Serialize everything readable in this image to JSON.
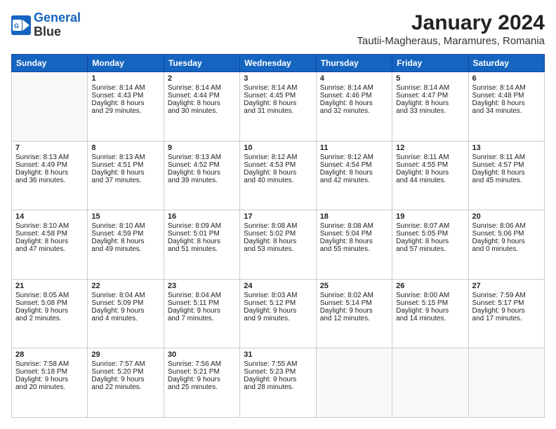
{
  "header": {
    "logo_line1": "General",
    "logo_line2": "Blue",
    "month_year": "January 2024",
    "location": "Tautii-Magheraus, Maramures, Romania"
  },
  "days_of_week": [
    "Sunday",
    "Monday",
    "Tuesday",
    "Wednesday",
    "Thursday",
    "Friday",
    "Saturday"
  ],
  "weeks": [
    [
      {
        "day": "",
        "info": ""
      },
      {
        "day": "1",
        "info": "Sunrise: 8:14 AM\nSunset: 4:43 PM\nDaylight: 8 hours\nand 29 minutes."
      },
      {
        "day": "2",
        "info": "Sunrise: 8:14 AM\nSunset: 4:44 PM\nDaylight: 8 hours\nand 30 minutes."
      },
      {
        "day": "3",
        "info": "Sunrise: 8:14 AM\nSunset: 4:45 PM\nDaylight: 8 hours\nand 31 minutes."
      },
      {
        "day": "4",
        "info": "Sunrise: 8:14 AM\nSunset: 4:46 PM\nDaylight: 8 hours\nand 32 minutes."
      },
      {
        "day": "5",
        "info": "Sunrise: 8:14 AM\nSunset: 4:47 PM\nDaylight: 8 hours\nand 33 minutes."
      },
      {
        "day": "6",
        "info": "Sunrise: 8:14 AM\nSunset: 4:48 PM\nDaylight: 8 hours\nand 34 minutes."
      }
    ],
    [
      {
        "day": "7",
        "info": "Sunrise: 8:13 AM\nSunset: 4:49 PM\nDaylight: 8 hours\nand 36 minutes."
      },
      {
        "day": "8",
        "info": "Sunrise: 8:13 AM\nSunset: 4:51 PM\nDaylight: 8 hours\nand 37 minutes."
      },
      {
        "day": "9",
        "info": "Sunrise: 8:13 AM\nSunset: 4:52 PM\nDaylight: 8 hours\nand 39 minutes."
      },
      {
        "day": "10",
        "info": "Sunrise: 8:12 AM\nSunset: 4:53 PM\nDaylight: 8 hours\nand 40 minutes."
      },
      {
        "day": "11",
        "info": "Sunrise: 8:12 AM\nSunset: 4:54 PM\nDaylight: 8 hours\nand 42 minutes."
      },
      {
        "day": "12",
        "info": "Sunrise: 8:11 AM\nSunset: 4:55 PM\nDaylight: 8 hours\nand 44 minutes."
      },
      {
        "day": "13",
        "info": "Sunrise: 8:11 AM\nSunset: 4:57 PM\nDaylight: 8 hours\nand 45 minutes."
      }
    ],
    [
      {
        "day": "14",
        "info": "Sunrise: 8:10 AM\nSunset: 4:58 PM\nDaylight: 8 hours\nand 47 minutes."
      },
      {
        "day": "15",
        "info": "Sunrise: 8:10 AM\nSunset: 4:59 PM\nDaylight: 8 hours\nand 49 minutes."
      },
      {
        "day": "16",
        "info": "Sunrise: 8:09 AM\nSunset: 5:01 PM\nDaylight: 8 hours\nand 51 minutes."
      },
      {
        "day": "17",
        "info": "Sunrise: 8:08 AM\nSunset: 5:02 PM\nDaylight: 8 hours\nand 53 minutes."
      },
      {
        "day": "18",
        "info": "Sunrise: 8:08 AM\nSunset: 5:04 PM\nDaylight: 8 hours\nand 55 minutes."
      },
      {
        "day": "19",
        "info": "Sunrise: 8:07 AM\nSunset: 5:05 PM\nDaylight: 8 hours\nand 57 minutes."
      },
      {
        "day": "20",
        "info": "Sunrise: 8:06 AM\nSunset: 5:06 PM\nDaylight: 9 hours\nand 0 minutes."
      }
    ],
    [
      {
        "day": "21",
        "info": "Sunrise: 8:05 AM\nSunset: 5:08 PM\nDaylight: 9 hours\nand 2 minutes."
      },
      {
        "day": "22",
        "info": "Sunrise: 8:04 AM\nSunset: 5:09 PM\nDaylight: 9 hours\nand 4 minutes."
      },
      {
        "day": "23",
        "info": "Sunrise: 8:04 AM\nSunset: 5:11 PM\nDaylight: 9 hours\nand 7 minutes."
      },
      {
        "day": "24",
        "info": "Sunrise: 8:03 AM\nSunset: 5:12 PM\nDaylight: 9 hours\nand 9 minutes."
      },
      {
        "day": "25",
        "info": "Sunrise: 8:02 AM\nSunset: 5:14 PM\nDaylight: 9 hours\nand 12 minutes."
      },
      {
        "day": "26",
        "info": "Sunrise: 8:00 AM\nSunset: 5:15 PM\nDaylight: 9 hours\nand 14 minutes."
      },
      {
        "day": "27",
        "info": "Sunrise: 7:59 AM\nSunset: 5:17 PM\nDaylight: 9 hours\nand 17 minutes."
      }
    ],
    [
      {
        "day": "28",
        "info": "Sunrise: 7:58 AM\nSunset: 5:18 PM\nDaylight: 9 hours\nand 20 minutes."
      },
      {
        "day": "29",
        "info": "Sunrise: 7:57 AM\nSunset: 5:20 PM\nDaylight: 9 hours\nand 22 minutes."
      },
      {
        "day": "30",
        "info": "Sunrise: 7:56 AM\nSunset: 5:21 PM\nDaylight: 9 hours\nand 25 minutes."
      },
      {
        "day": "31",
        "info": "Sunrise: 7:55 AM\nSunset: 5:23 PM\nDaylight: 9 hours\nand 28 minutes."
      },
      {
        "day": "",
        "info": ""
      },
      {
        "day": "",
        "info": ""
      },
      {
        "day": "",
        "info": ""
      }
    ]
  ]
}
